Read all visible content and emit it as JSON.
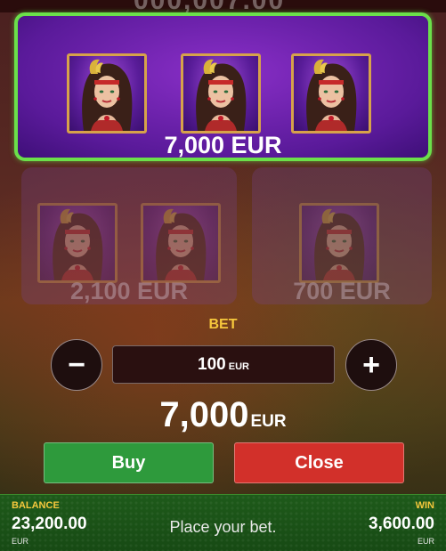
{
  "top_ghost_text": "000,007.00",
  "prizes": {
    "main": {
      "amount": "7,000 EUR",
      "symbol_count": 3
    },
    "second": {
      "amount": "2,100 EUR",
      "symbol_count": 2
    },
    "third": {
      "amount": "700 EUR",
      "symbol_count": 1
    }
  },
  "bet": {
    "label": "BET",
    "value": "100",
    "currency": "EUR"
  },
  "total": {
    "value": "7,000",
    "currency": "EUR"
  },
  "buttons": {
    "minus": "−",
    "plus": "+",
    "buy": "Buy",
    "close": "Close"
  },
  "footer": {
    "balance_label": "BALANCE",
    "balance_value": "23,200.00",
    "balance_currency": "EUR",
    "message": "Place your bet.",
    "win_label": "WIN",
    "win_value": "3,600.00",
    "win_currency": "EUR"
  },
  "colors": {
    "accent_yellow": "#f6c83c",
    "selected_border": "#6be04a",
    "buy_green": "#2e9a3c",
    "close_red": "#d2302a"
  }
}
